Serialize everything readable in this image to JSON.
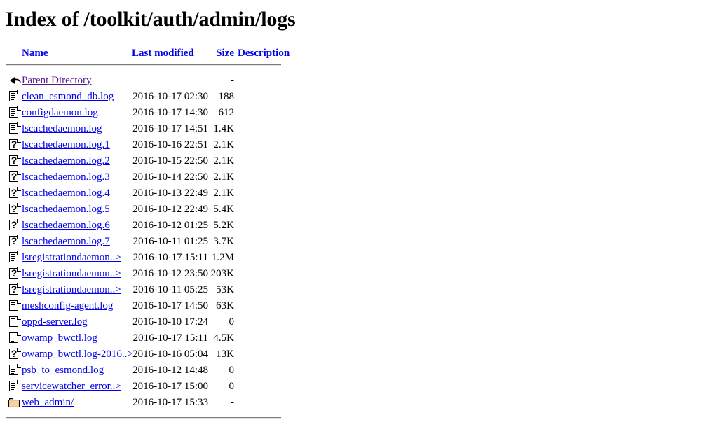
{
  "page": {
    "title": "Index of /toolkit/auth/admin/logs"
  },
  "columns": {
    "name": "Name",
    "last_modified": "Last modified",
    "size": "Size",
    "description": "Description"
  },
  "entries": [
    {
      "icon": "back-icon",
      "name": "Parent Directory",
      "last_modified": "",
      "size": "-",
      "description": "",
      "visited": true
    },
    {
      "icon": "text-file-icon",
      "name": "clean_esmond_db.log",
      "last_modified": "2016-10-17 02:30",
      "size": "188",
      "description": ""
    },
    {
      "icon": "text-file-icon",
      "name": "configdaemon.log",
      "last_modified": "2016-10-17 14:30",
      "size": "612",
      "description": ""
    },
    {
      "icon": "text-file-icon",
      "name": "lscachedaemon.log",
      "last_modified": "2016-10-17 14:51",
      "size": "1.4K",
      "description": ""
    },
    {
      "icon": "unknown-file-icon",
      "name": "lscachedaemon.log.1",
      "last_modified": "2016-10-16 22:51",
      "size": "2.1K",
      "description": ""
    },
    {
      "icon": "unknown-file-icon",
      "name": "lscachedaemon.log.2",
      "last_modified": "2016-10-15 22:50",
      "size": "2.1K",
      "description": ""
    },
    {
      "icon": "unknown-file-icon",
      "name": "lscachedaemon.log.3",
      "last_modified": "2016-10-14 22:50",
      "size": "2.1K",
      "description": ""
    },
    {
      "icon": "unknown-file-icon",
      "name": "lscachedaemon.log.4",
      "last_modified": "2016-10-13 22:49",
      "size": "2.1K",
      "description": ""
    },
    {
      "icon": "unknown-file-icon",
      "name": "lscachedaemon.log.5",
      "last_modified": "2016-10-12 22:49",
      "size": "5.4K",
      "description": ""
    },
    {
      "icon": "unknown-file-icon",
      "name": "lscachedaemon.log.6",
      "last_modified": "2016-10-12 01:25",
      "size": "5.2K",
      "description": ""
    },
    {
      "icon": "unknown-file-icon",
      "name": "lscachedaemon.log.7",
      "last_modified": "2016-10-11 01:25",
      "size": "3.7K",
      "description": ""
    },
    {
      "icon": "text-file-icon",
      "name": "lsregistrationdaemon..>",
      "last_modified": "2016-10-17 15:11",
      "size": "1.2M",
      "description": ""
    },
    {
      "icon": "unknown-file-icon",
      "name": "lsregistrationdaemon..>",
      "last_modified": "2016-10-12 23:50",
      "size": "203K",
      "description": ""
    },
    {
      "icon": "unknown-file-icon",
      "name": "lsregistrationdaemon..>",
      "last_modified": "2016-10-11 05:25",
      "size": "53K",
      "description": ""
    },
    {
      "icon": "text-file-icon",
      "name": "meshconfig-agent.log",
      "last_modified": "2016-10-17 14:50",
      "size": "63K",
      "description": ""
    },
    {
      "icon": "text-file-icon",
      "name": "oppd-server.log",
      "last_modified": "2016-10-10 17:24",
      "size": "0",
      "description": ""
    },
    {
      "icon": "text-file-icon",
      "name": "owamp_bwctl.log",
      "last_modified": "2016-10-17 15:11",
      "size": "4.5K",
      "description": ""
    },
    {
      "icon": "unknown-file-icon",
      "name": "owamp_bwctl.log-2016..>",
      "last_modified": "2016-10-16 05:04",
      "size": "13K",
      "description": "",
      "long": true
    },
    {
      "icon": "text-file-icon",
      "name": "psb_to_esmond.log",
      "last_modified": "2016-10-12 14:48",
      "size": "0",
      "description": ""
    },
    {
      "icon": "text-file-icon",
      "name": "servicewatcher_error..>",
      "last_modified": "2016-10-17 15:00",
      "size": "0",
      "description": ""
    },
    {
      "icon": "folder-icon",
      "name": "web_admin/",
      "last_modified": "2016-10-17 15:33",
      "size": "-",
      "description": ""
    }
  ],
  "colors": {
    "link": "#0000EE",
    "visited_link": "#551A8B",
    "text": "#000000",
    "background": "#FFFFFF",
    "folder": "#EEC48C"
  }
}
